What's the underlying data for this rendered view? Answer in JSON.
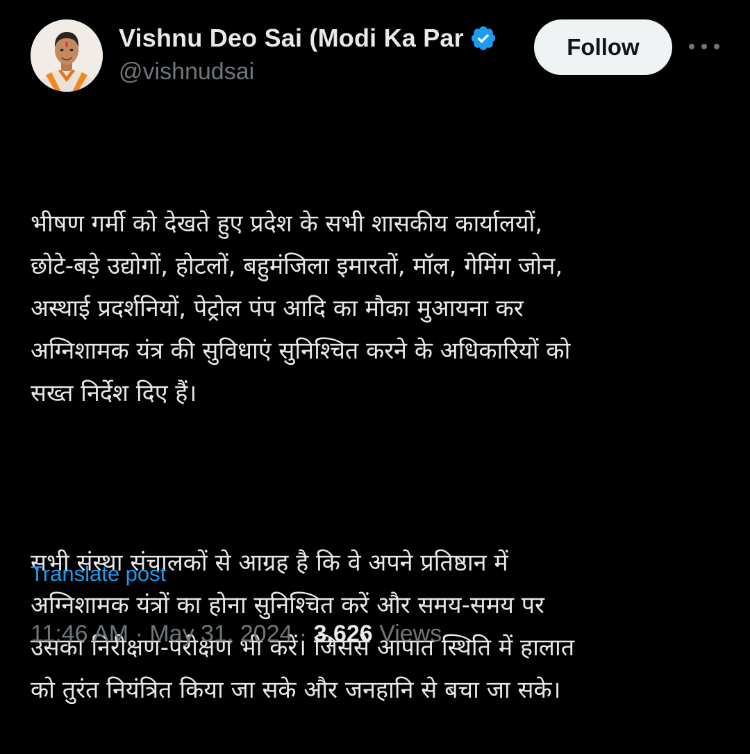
{
  "author": {
    "display_name": "Vishnu Deo Sai (Modi Ka Par",
    "handle": "@vishnudsai",
    "verified_icon": "verified-badge-icon",
    "avatar_icon": "avatar"
  },
  "actions": {
    "follow_label": "Follow",
    "more_icon": "more-icon"
  },
  "tweet": {
    "paragraph_1": "भीषण गर्मी को देखते हुए प्रदेश के सभी शासकीय कार्यालयों,\nछोटे-बड़े उद्योगों, होटलों, बहुमंजिला इमारतों, मॉल, गेमिंग जोन,\nअस्थाई प्रदर्शनियों, पेट्रोल पंप आदि का मौका मुआयना कर\nअग्निशामक यंत्र की सुविधाएं सुनिश्चित करने के अधिकारियों को\nसख्त निर्देश दिए हैं।",
    "paragraph_2": "सभी संस्था संचालकों से आग्रह है कि वे अपने प्रतिष्ठान में\nअग्निशामक यंत्रों का होना सुनिश्चित करें और समय-समय पर\nउसका निरीक्षण-परीक्षण भी करें। जिससे आपात स्थिति में हालात\nको तुरंत नियंत्रित किया जा सके और जनहानि से बचा जा सके।",
    "translate_label": "Translate post"
  },
  "meta": {
    "time": "11:46 AM",
    "separator": " · ",
    "date": "May 31, 2024",
    "views_count": "3,626",
    "views_label": " Views"
  },
  "colors": {
    "background": "#000000",
    "text": "#e7e9ea",
    "muted": "#71767b",
    "link": "#1d9bf0",
    "verified": "#1d9bf0"
  }
}
